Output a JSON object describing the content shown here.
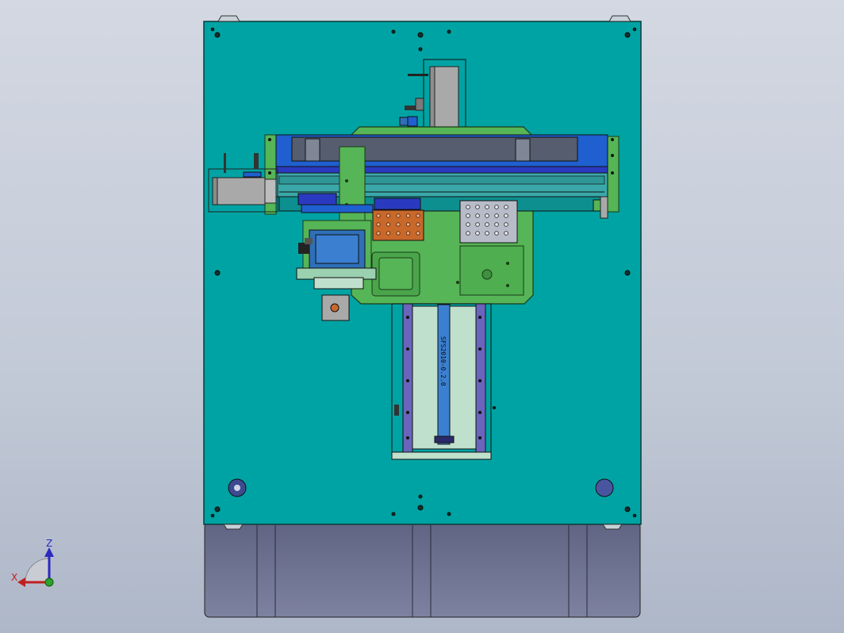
{
  "viewport": {
    "background_top": "#d3d8e2",
    "background_bottom": "#aeb7c8"
  },
  "model": {
    "screw_label": "SFS2010-0.2.0",
    "colors": {
      "base_plate": "#00a3a3",
      "base_plate_edge": "#0a3a3a",
      "lower_cabinet": "#6e7390",
      "bracket_green": "#56b556",
      "rail_blue": "#1f5fcf",
      "linear_guide": "#6a64bc",
      "orange_tray": "#c8682a",
      "gray_tray": "#b8bcc8",
      "motor_gray": "#a9a9a9",
      "motor_blue": "#2f6fb8",
      "ball_screw": "#3b7fd0"
    }
  },
  "triad": {
    "z_label": "Z",
    "x_label": "X",
    "z_color": "#2a2ac0",
    "x_color": "#c02020"
  }
}
